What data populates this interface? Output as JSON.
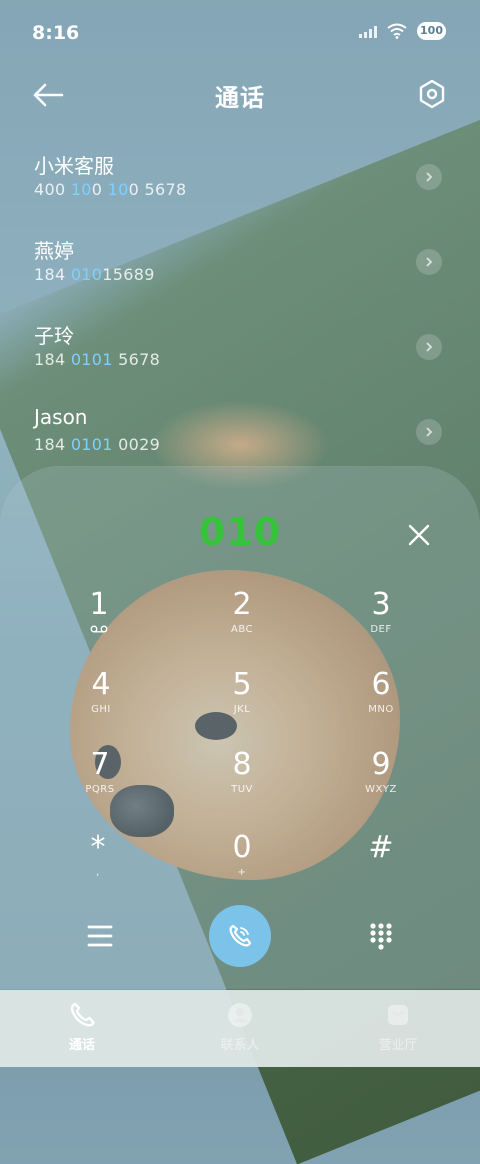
{
  "status_bar": {
    "time": "8:16",
    "battery": "100"
  },
  "header": {
    "title": "通话"
  },
  "contacts": [
    {
      "name": "小米客服",
      "number_parts": [
        "400 ",
        "10",
        "0 ",
        "10",
        "0 5678"
      ]
    },
    {
      "name": "燕婷",
      "number_parts": [
        "184 ",
        "010",
        "15689",
        "",
        ""
      ]
    },
    {
      "name": "子玲",
      "number_parts": [
        "184 ",
        "0101",
        " 5678",
        "",
        ""
      ]
    },
    {
      "name": "Jason",
      "number_parts": [
        "184 ",
        "0101",
        " 0029",
        "",
        ""
      ]
    }
  ],
  "dialer": {
    "input": "010",
    "keys": [
      {
        "num": "1",
        "sub": ""
      },
      {
        "num": "2",
        "sub": "ABC"
      },
      {
        "num": "3",
        "sub": "DEF"
      },
      {
        "num": "4",
        "sub": "GHI"
      },
      {
        "num": "5",
        "sub": "JKL"
      },
      {
        "num": "6",
        "sub": "MNO"
      },
      {
        "num": "7",
        "sub": "PQRS"
      },
      {
        "num": "8",
        "sub": "TUV"
      },
      {
        "num": "9",
        "sub": "WXYZ"
      },
      {
        "num": "*",
        "sub": ","
      },
      {
        "num": "0",
        "sub": "+"
      },
      {
        "num": "#",
        "sub": ""
      }
    ]
  },
  "tabs": [
    {
      "label": "通话",
      "icon": "phone-icon",
      "active": true
    },
    {
      "label": "联系人",
      "icon": "contacts-icon",
      "active": false
    },
    {
      "label": "营业厅",
      "icon": "store-icon",
      "active": false
    }
  ],
  "colors": {
    "input_digits": "#36c23a",
    "highlight": "#7fd0ff",
    "call_button": "#7cc3ea"
  }
}
